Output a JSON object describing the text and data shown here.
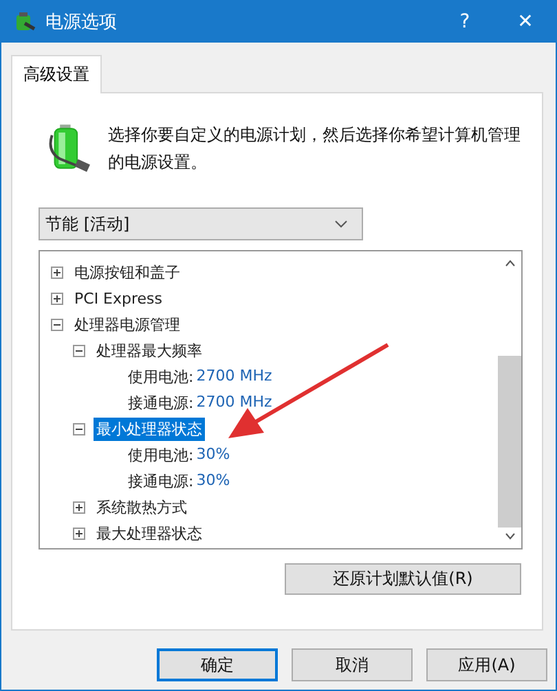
{
  "window": {
    "title": "电源选项",
    "help": "?",
    "close": "✕"
  },
  "tabs": [
    {
      "label": "高级设置",
      "selected": true
    }
  ],
  "description": "选择你要自定义的电源计划，然后选择你希望计算机管理的电源设置。",
  "plan_dropdown": {
    "value": "节能 [活动]"
  },
  "settings_tree": [
    {
      "kind": "group",
      "label": "电源按钮和盖子",
      "expanded": false,
      "selected": false
    },
    {
      "kind": "group",
      "label": "PCI Express",
      "expanded": false,
      "selected": false
    },
    {
      "kind": "group",
      "label": "处理器电源管理",
      "expanded": true,
      "selected": false,
      "children": [
        {
          "kind": "group",
          "label": "处理器最大频率",
          "expanded": true,
          "selected": false,
          "children": [
            {
              "kind": "setting",
              "label": "使用电池:",
              "value": "2700 MHz",
              "selected": false
            },
            {
              "kind": "setting",
              "label": "接通电源:",
              "value": "2700 MHz",
              "selected": false
            }
          ]
        },
        {
          "kind": "group",
          "label": "最小处理器状态",
          "expanded": true,
          "selected": true,
          "children": [
            {
              "kind": "setting",
              "label": "使用电池:",
              "value": "30%",
              "selected": false
            },
            {
              "kind": "setting",
              "label": "接通电源:",
              "value": "30%",
              "selected": false
            }
          ]
        },
        {
          "kind": "group",
          "label": "系统散热方式",
          "expanded": false,
          "selected": false
        },
        {
          "kind": "group",
          "label": "最大处理器状态",
          "expanded": false,
          "selected": false
        }
      ]
    }
  ],
  "restore_button": "还原计划默认值(R)",
  "buttons": [
    {
      "label": "确定",
      "default": true
    },
    {
      "label": "取消",
      "default": false
    },
    {
      "label": "应用(A)",
      "default": false
    }
  ]
}
